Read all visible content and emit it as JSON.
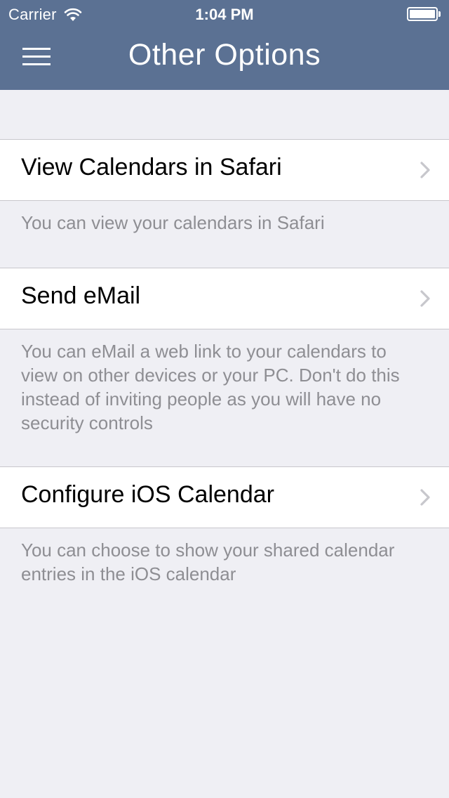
{
  "status_bar": {
    "carrier": "Carrier",
    "time": "1:04 PM"
  },
  "nav": {
    "title": "Other Options",
    "menu_icon": "hamburger-menu-icon"
  },
  "options": [
    {
      "label": "View Calendars in Safari",
      "footer": "You can view your calendars in Safari"
    },
    {
      "label": "Send eMail",
      "footer": "You can eMail a web link to your calendars to view on other devices or your PC. Don't do this instead of inviting people as you will have no security controls"
    },
    {
      "label": "Configure iOS Calendar",
      "footer": "You can choose to show your shared calendar entries in the iOS calendar"
    }
  ],
  "colors": {
    "nav_background": "#5b7193",
    "page_background": "#efeff4",
    "footer_text": "#8e8e93",
    "chevron": "#c7c7cc"
  }
}
